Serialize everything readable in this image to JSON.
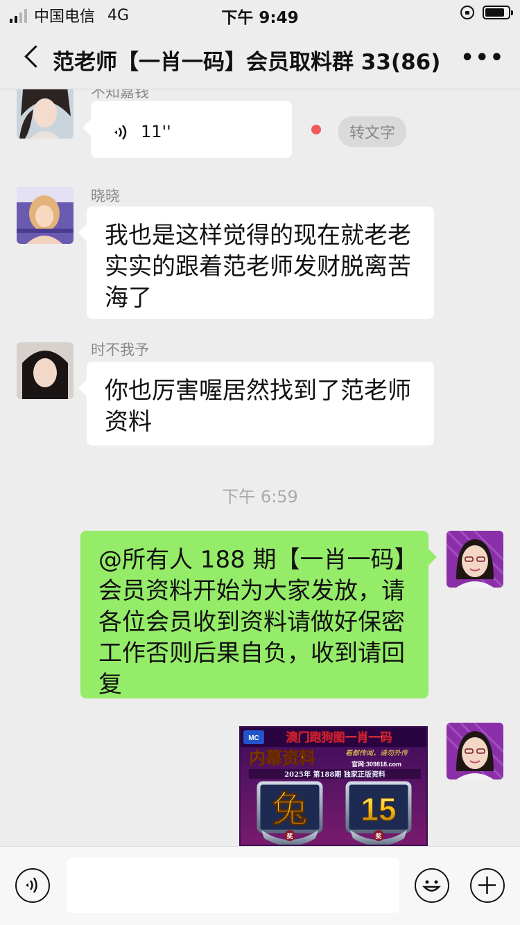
{
  "status_bar": {
    "carrier": "中国电信",
    "network": "4G",
    "time": "下午 9:49",
    "battery_level": 0.85
  },
  "nav": {
    "title": "范老师【一肖一码】会员取料群 33(86)",
    "more_label": "•••"
  },
  "messages": [
    {
      "type": "voice",
      "sender": "不知嘉钱",
      "duration": "11''",
      "transcribe_label": "转文字"
    },
    {
      "type": "text",
      "sender": "晓晓",
      "text": "我也是这样觉得的现在就老老实实的跟着范老师发财脱离苦海了"
    },
    {
      "type": "text",
      "sender": "时不我予",
      "text": "你也厉害喔居然找到了范老师资料"
    },
    {
      "type": "timestamp",
      "text": "下午 6:59"
    },
    {
      "type": "text",
      "sender": "self",
      "text": "@所有人 188 期【一肖一码】会员资料开始为大家发放，请各位会员收到资料请做好保密工作否则后果自负，收到请回复"
    },
    {
      "type": "image",
      "sender": "self"
    }
  ],
  "poster": {
    "logo": "MC",
    "headline": "澳门跑狗图一肖一码",
    "subtitle": "内幕资料",
    "slogan": "看都传闻，请勿外传",
    "website": "官网:309818.com",
    "issue_line": "2025年 第188期 独家正版资料",
    "zodiac": "兔",
    "number": "15",
    "badge_label": "奖"
  },
  "colors": {
    "accent_green": "#95ec69",
    "background": "#ededed",
    "bubble_white": "#ffffff"
  },
  "icons": [
    "back-chevron-icon",
    "more-icon",
    "voice-icon",
    "lock-rotation-icon",
    "battery-icon",
    "voice-input-icon",
    "emoji-icon",
    "add-icon"
  ]
}
